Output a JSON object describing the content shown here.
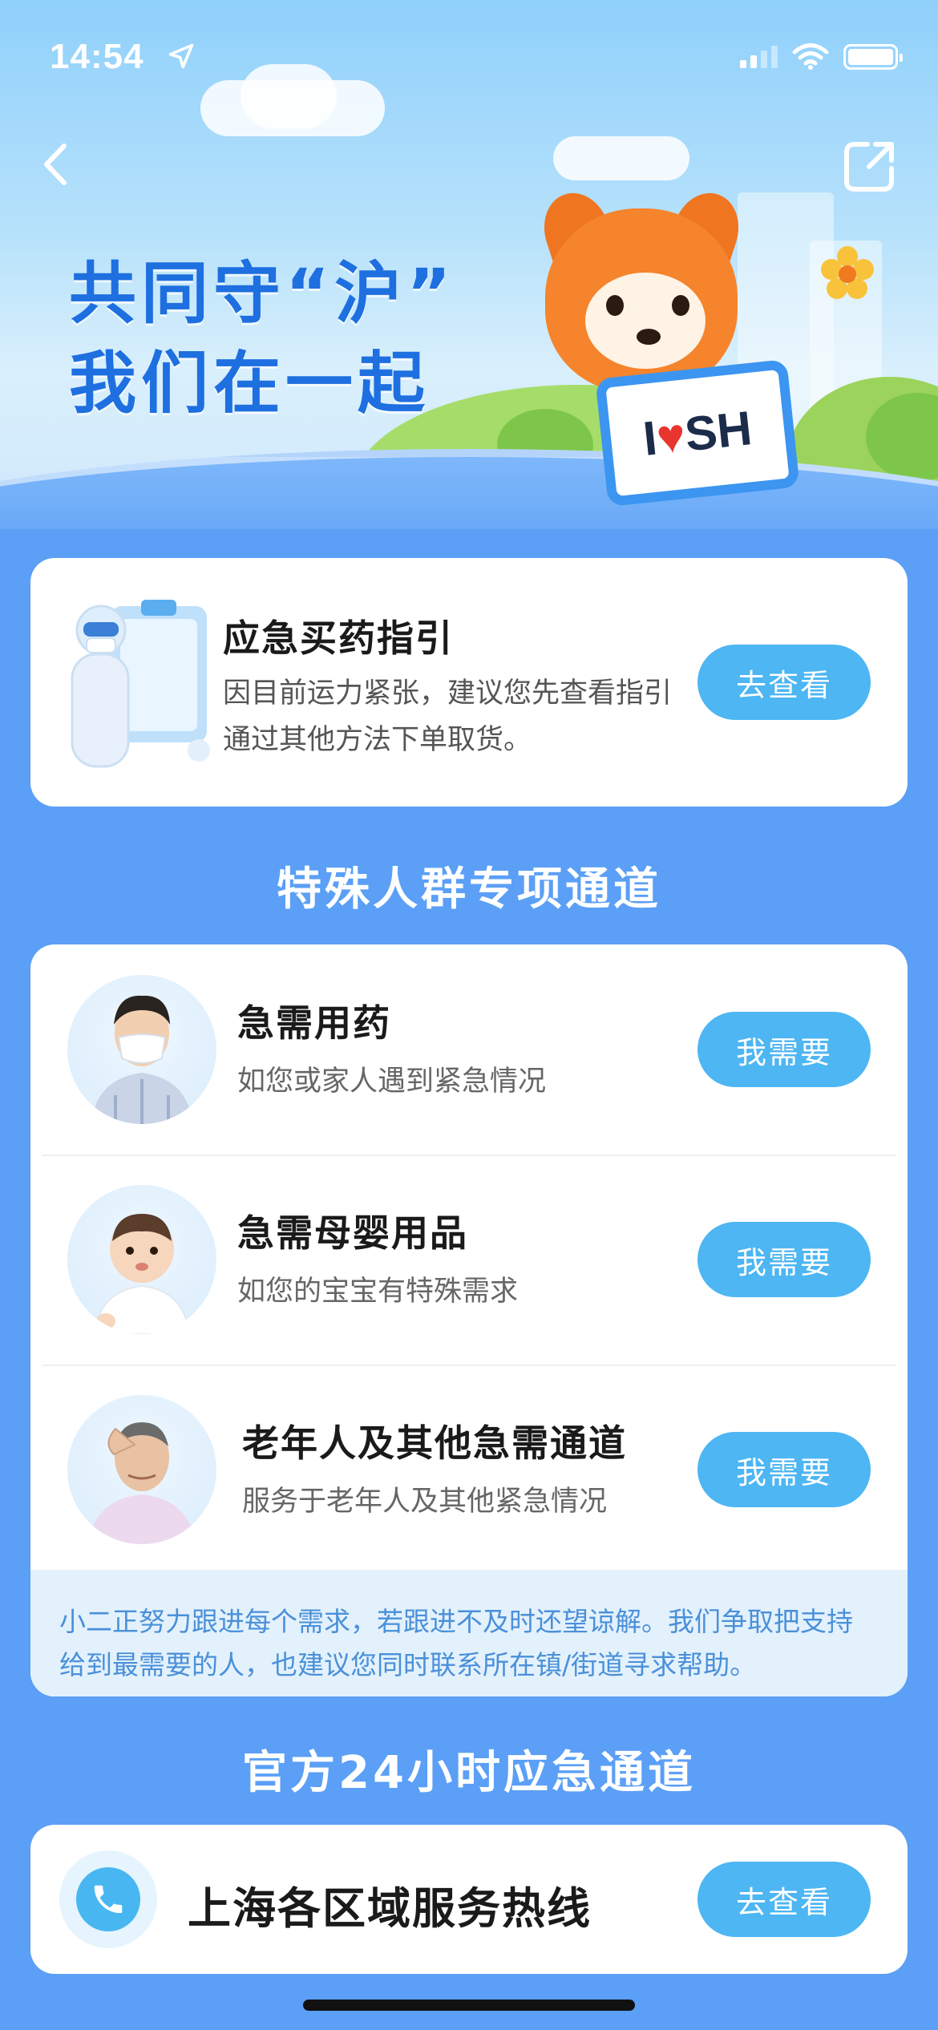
{
  "status_bar": {
    "time": "14:54",
    "location_icon": "location-arrow-icon",
    "signal_icon": "cellular-signal-icon",
    "wifi_icon": "wifi-icon",
    "battery_icon": "battery-icon"
  },
  "nav": {
    "back_icon": "chevron-left-icon",
    "share_icon": "share-icon"
  },
  "hero": {
    "slogan_line1": "共同守“沪”",
    "slogan_line2": "我们在一起",
    "sign_text_left": "I",
    "sign_text_right": "SH"
  },
  "guide": {
    "title": "应急买药指引",
    "description": "因目前运力紧张，建议您先查看指引通过其他方法下单取货。",
    "button": "去查看"
  },
  "special": {
    "section_title": "特殊人群专项通道",
    "rows": [
      {
        "name": "急需用药",
        "sub": "如您或家人遇到紧急情况",
        "button": "我需要"
      },
      {
        "name": "急需母婴用品",
        "sub": "如您的宝宝有特殊需求",
        "button": "我需要"
      },
      {
        "name": "老年人及其他急需通道",
        "sub": "服务于老年人及其他紧急情况",
        "button": "我需要"
      }
    ],
    "notice": "小二正努力跟进每个需求，若跟进不及时还望谅解。我们争取把支持给到最需要的人，也建议您同时联系所在镇/街道寻求帮助。"
  },
  "official": {
    "section_title": "官方24小时应急通道",
    "hotline_title": "上海各区域服务热线",
    "button": "去查看"
  },
  "colors": {
    "page_bg": "#5b9ff6",
    "button_bg": "#4db6f3",
    "slogan": "#1e6fe0",
    "notice_bg": "#e3f1fc",
    "notice_text": "#4a90d9"
  }
}
